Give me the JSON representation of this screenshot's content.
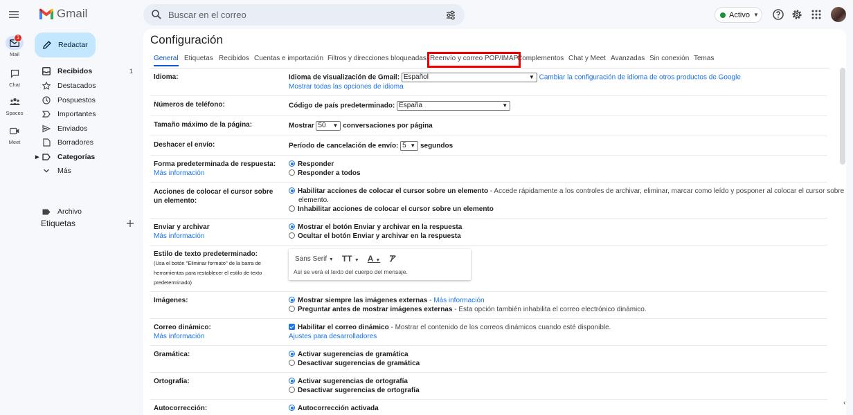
{
  "app": {
    "name": "Gmail"
  },
  "search": {
    "placeholder": "Buscar en el correo"
  },
  "status": {
    "label": "Activo",
    "color": "#1e8e3e"
  },
  "rail": [
    {
      "label": "Mail",
      "badge": "1"
    },
    {
      "label": "Chat"
    },
    {
      "label": "Spaces"
    },
    {
      "label": "Meet"
    }
  ],
  "nav": {
    "compose": "Redactar",
    "items": [
      {
        "label": "Recibidos",
        "count": "1",
        "icon": "inbox-icon"
      },
      {
        "label": "Destacados",
        "icon": "star-icon"
      },
      {
        "label": "Pospuestos",
        "icon": "clock-icon"
      },
      {
        "label": "Importantes",
        "icon": "important-icon"
      },
      {
        "label": "Enviados",
        "icon": "send-icon"
      },
      {
        "label": "Borradores",
        "icon": "draft-icon"
      },
      {
        "label": "Categorías",
        "icon": "label-icon"
      },
      {
        "label": "Más",
        "icon": "chevron-down-icon"
      }
    ],
    "labels_title": "Etiquetas",
    "labels": [
      {
        "label": "Archivo"
      }
    ]
  },
  "settings": {
    "title": "Configuración",
    "tabs": [
      "General",
      "Etiquetas",
      "Recibidos",
      "Cuentas e importación",
      "Filtros y direcciones bloqueadas",
      "Reenvío y correo POP/IMAP",
      "Complementos",
      "Chat y Meet",
      "Avanzadas",
      "Sin conexión",
      "Temas"
    ],
    "active_tab": "General",
    "highlighted_tab": "Reenvío y correo POP/IMAP",
    "more_info": "Más información",
    "language": {
      "label": "Idioma:",
      "display_label": "Idioma de visualización de Gmail:",
      "value": "Español",
      "change_link": "Cambiar la configuración de idioma de otros productos de Google",
      "all_options": "Mostrar todas las opciones de idioma"
    },
    "phone": {
      "label": "Números de teléfono:",
      "country_label": "Código de país predeterminado:",
      "value": "España"
    },
    "page_size": {
      "label": "Tamaño máximo de la página:",
      "prefix": "Mostrar",
      "value": "50",
      "suffix": "conversaciones por página"
    },
    "undo_send": {
      "label": "Deshacer el envío:",
      "prefix": "Período de cancelación de envío:",
      "value": "5",
      "suffix": "segundos"
    },
    "reply": {
      "label": "Forma predeterminada de respuesta:",
      "opt1": "Responder",
      "opt2": "Responder a todos"
    },
    "hover": {
      "label": "Acciones de colocar el cursor sobre un elemento:",
      "opt1": "Habilitar acciones de colocar el cursor sobre un elemento",
      "opt1_desc": " - Accede rápidamente a los controles de archivar, eliminar, marcar como leído y posponer al colocar el cursor sobre un",
      "opt1_desc2": "elemento.",
      "opt2": "Inhabilitar acciones de colocar el cursor sobre un elemento"
    },
    "send_archive": {
      "label": "Enviar y archivar",
      "opt1": "Mostrar el botón Enviar y archivar en la respuesta",
      "opt2": "Ocultar el botón Enviar y archivar en la respuesta"
    },
    "text_style": {
      "label": "Estilo de texto predeterminado:",
      "note": "(Usa el botón \"Eliminar formato\" de la barra de herramientas para restablecer el estilo de texto predeterminado)",
      "font": "Sans Serif",
      "preview": "Así se verá el texto del cuerpo del mensaje."
    },
    "images": {
      "label": "Imágenes:",
      "opt1": "Mostrar siempre las imágenes externas",
      "opt1_sep": " - ",
      "opt2": "Preguntar antes de mostrar imágenes externas",
      "opt2_desc": " - Esta opción también inhabilita el correo electrónico dinámico."
    },
    "dynamic": {
      "label": "Correo dinámico:",
      "opt": "Habilitar el correo dinámico",
      "opt_desc": " - Mostrar el contenido de los correos dinámicos cuando esté disponible.",
      "dev_link": "Ajustes para desarrolladores"
    },
    "grammar": {
      "label": "Gramática:",
      "opt1": "Activar sugerencias de gramática",
      "opt2": "Desactivar sugerencias de gramática"
    },
    "spelling": {
      "label": "Ortografía:",
      "opt1": "Activar sugerencias de ortografía",
      "opt2": "Desactivar sugerencias de ortografía"
    },
    "autocorrect": {
      "label": "Autocorrección:",
      "opt1": "Autocorrección activada"
    }
  }
}
